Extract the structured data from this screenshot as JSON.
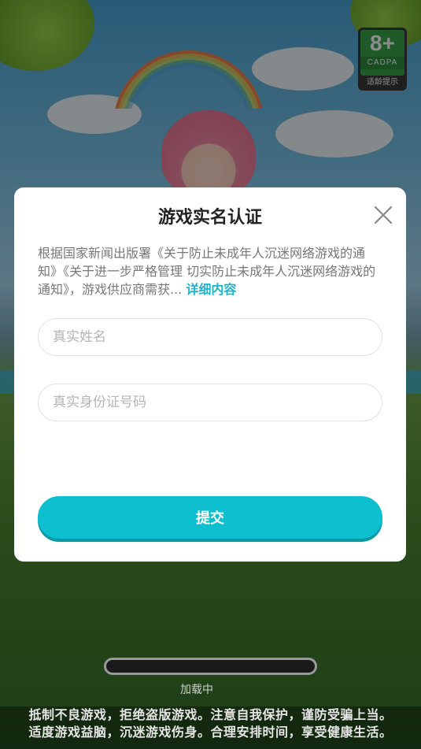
{
  "rating": {
    "age": "8+",
    "org": "CADPA",
    "tip": "适龄提示"
  },
  "dialog": {
    "title": "游戏实名认证",
    "notice_text": "根据国家新闻出版署《关于防止未成年人沉迷网络游戏的通知》《关于进一步严格管理 切实防止未成年人沉迷网络游戏的通知》，游戏供应商需获...",
    "detail_link": "详细内容",
    "name_placeholder": "真实姓名",
    "id_placeholder": "真实身份证号码",
    "submit_label": "提交"
  },
  "loading": {
    "text": "加载中"
  },
  "health_notice": {
    "line1": "抵制不良游戏，拒绝盗版游戏。注意自我保护，谨防受骗上当。",
    "line2": "适度游戏益脑，沉迷游戏伤身。合理安排时间，享受健康生活。"
  },
  "colors": {
    "accent": "#0ebfcf",
    "link": "#1fb3c9",
    "rating_green": "#3aa64a"
  }
}
